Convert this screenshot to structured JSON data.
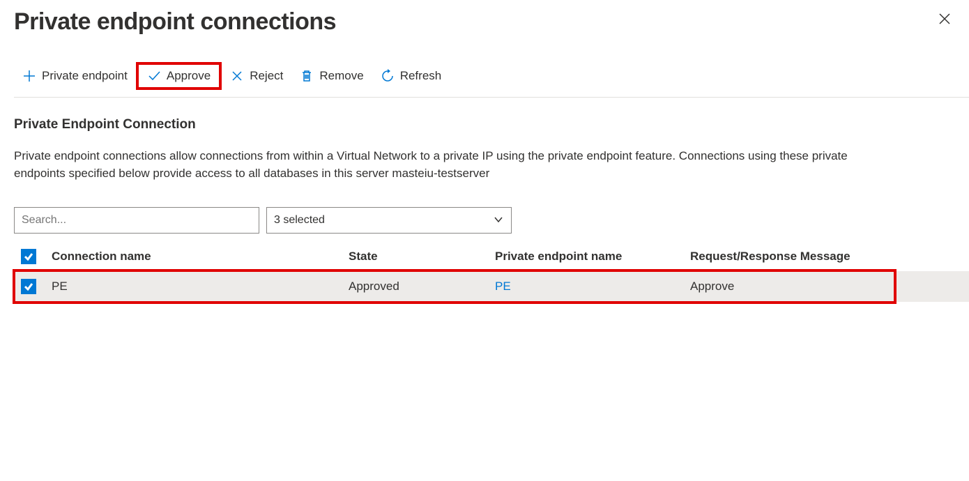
{
  "header": {
    "title": "Private endpoint connections"
  },
  "toolbar": {
    "add_label": "Private endpoint",
    "approve_label": "Approve",
    "reject_label": "Reject",
    "remove_label": "Remove",
    "refresh_label": "Refresh"
  },
  "section": {
    "title": "Private Endpoint Connection",
    "description_line1": "Private endpoint connections allow connections from within a Virtual Network to a private IP using the private endpoint feature. Connections using these private",
    "description_line2": "endpoints specified below provide access to all databases in this server masteiu-testserver"
  },
  "filters": {
    "search_placeholder": "Search...",
    "selected_label": "3 selected"
  },
  "table": {
    "headers": {
      "name": "Connection name",
      "state": "State",
      "pe": "Private endpoint name",
      "msg": "Request/Response Message"
    },
    "rows": [
      {
        "name": "PE",
        "state": "Approved",
        "pe": "PE",
        "msg": "Approve"
      }
    ]
  }
}
